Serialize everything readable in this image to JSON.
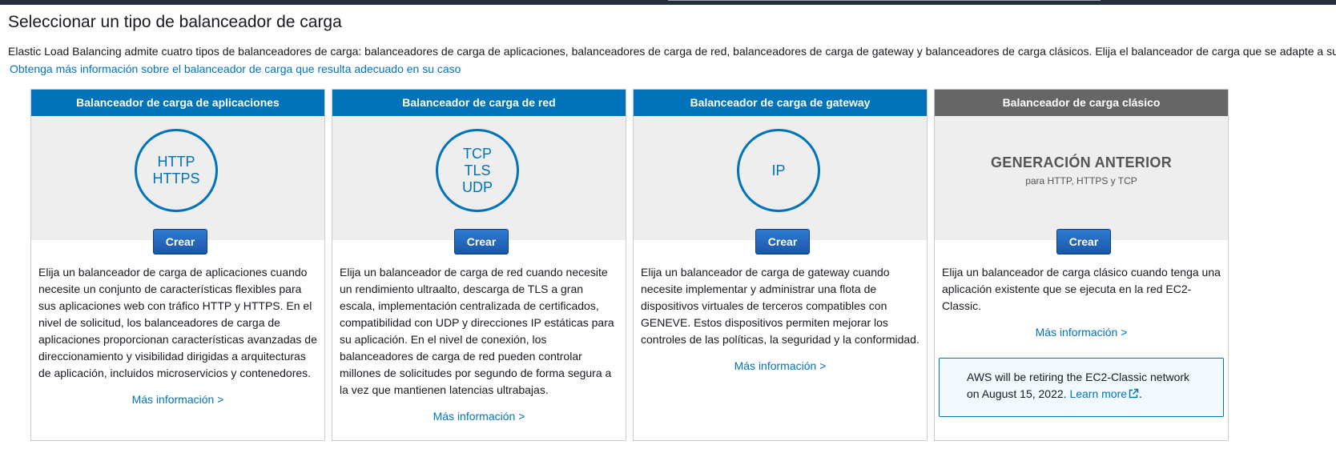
{
  "page": {
    "title": "Seleccionar un tipo de balanceador de carga",
    "intro": "Elastic Load Balancing admite cuatro tipos de balanceadores de carga: balanceadores de carga de aplicaciones, balanceadores de carga de red, balanceadores de carga de gateway y balanceadores de carga clásicos. Elija el balanceador de carga que se adapte a su",
    "intro_link": "Obtenga más información sobre el balanceador de carga que resulta adecuado en su caso"
  },
  "colors": {
    "accent": "#0073bb",
    "classic_header": "#666666",
    "button": "#1f62b8"
  },
  "cards": [
    {
      "title": "Balanceador de carga de aplicaciones",
      "protocols": [
        "HTTP",
        "HTTPS"
      ],
      "create_label": "Crear",
      "description": "Elija un balanceador de carga de aplicaciones cuando necesite un conjunto de características flexibles para sus aplicaciones web con tráfico HTTP y HTTPS. En el nivel de solicitud, los balanceadores de carga de aplicaciones proporcionan características avanzadas de direccionamiento y visibilidad dirigidas a arquitecturas de aplicación, incluidos microservicios y contenedores.",
      "more_label": "Más información >"
    },
    {
      "title": "Balanceador de carga de red",
      "protocols": [
        "TCP",
        "TLS",
        "UDP"
      ],
      "create_label": "Crear",
      "description": "Elija un balanceador de carga de red cuando necesite un rendimiento ultraalto, descarga de TLS a gran escala, implementación centralizada de certificados, compatibilidad con UDP y direcciones IP estáticas para su aplicación. En el nivel de conexión, los balanceadores de carga de red pueden controlar millones de solicitudes por segundo de forma segura a la vez que mantienen latencias ultrabajas.",
      "more_label": "Más información >"
    },
    {
      "title": "Balanceador de carga de gateway",
      "protocols": [
        "IP"
      ],
      "create_label": "Crear",
      "description": "Elija un balanceador de carga de gateway cuando necesite implementar y administrar una flota de dispositivos virtuales de terceros compatibles con GENEVE. Estos dispositivos permiten mejorar los controles de las políticas, la seguridad y la conformidad.",
      "more_label": "Más información >"
    },
    {
      "title": "Balanceador de carga clásico",
      "previous_generation": "GENERACIÓN ANTERIOR",
      "previous_generation_sub": "para HTTP, HTTPS y TCP",
      "create_label": "Crear",
      "description": "Elija un balanceador de carga clásico cuando tenga una aplicación existente que se ejecuta en la red EC2-Classic.",
      "more_label": "Más información >",
      "notice": {
        "text_line1": "AWS will be retiring the EC2-Classic network",
        "text_line2": "on August 15, 2022.",
        "link": "Learn more",
        "period": ".",
        "icon": "external-link-icon"
      }
    }
  ]
}
